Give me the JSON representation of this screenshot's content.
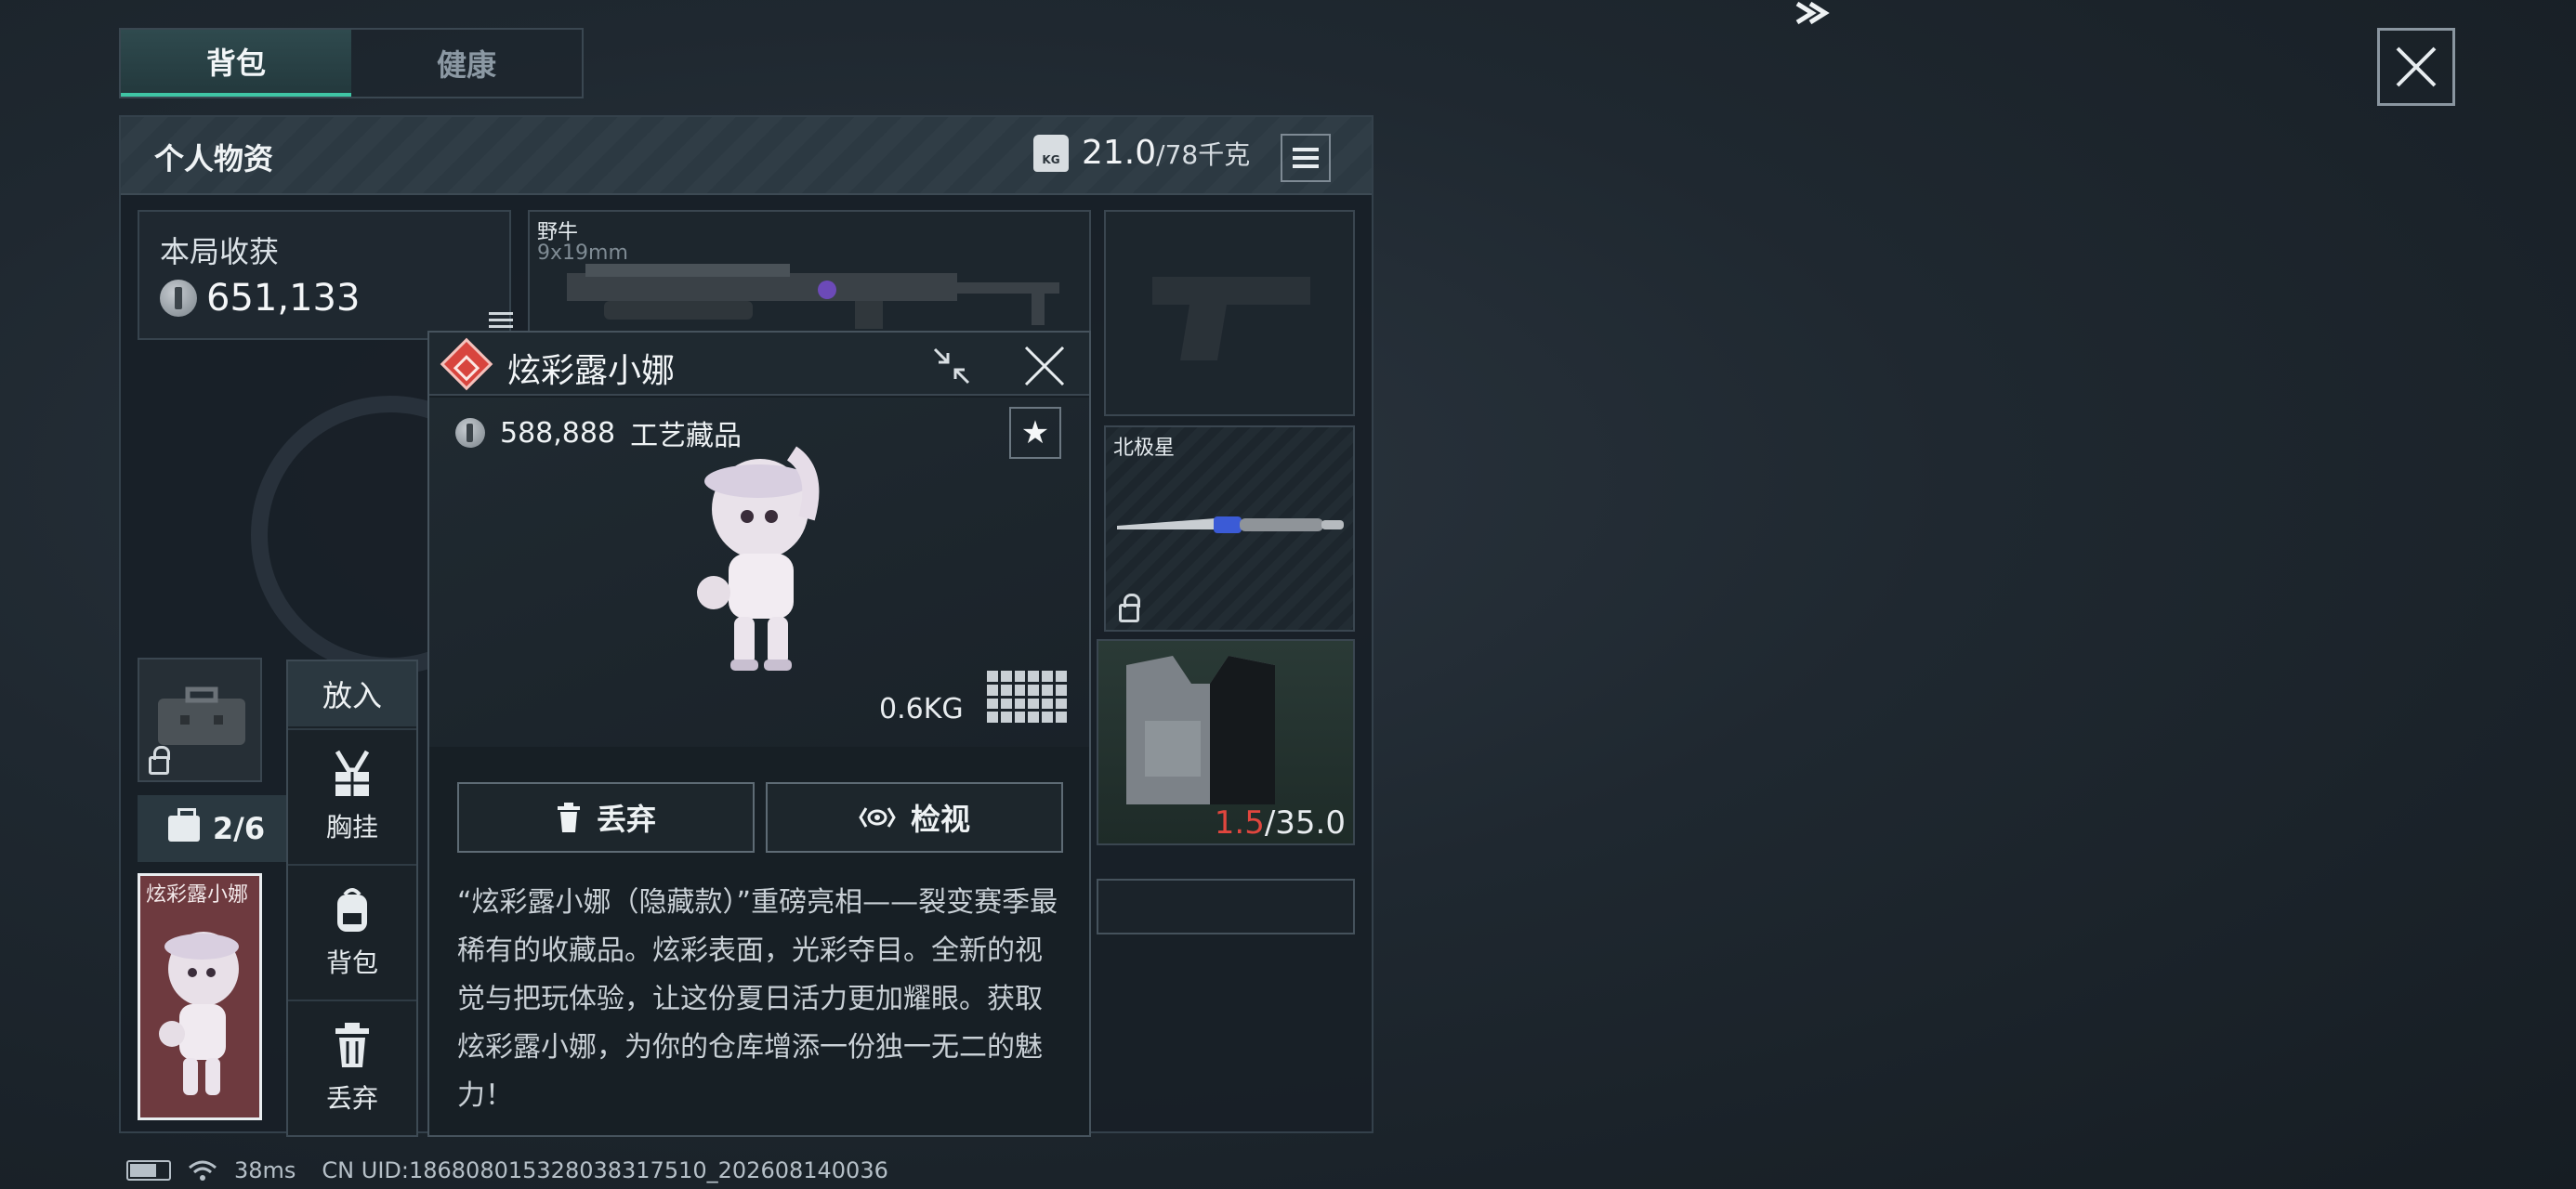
{
  "tabs": [
    {
      "label": "背包",
      "active": true
    },
    {
      "label": "健康",
      "active": false
    }
  ],
  "panel": {
    "title": "个人物资",
    "weight_current": "21.0",
    "weight_max": "/78千克",
    "kg_icon_text": "KG"
  },
  "haul": {
    "label": "本局收获",
    "value": "651,133"
  },
  "slots": {
    "rifle": {
      "name": "野牛",
      "caliber": "9x19mm"
    },
    "knife": {
      "name": "北极星"
    },
    "vest": {
      "durability_current": "1.5",
      "durability_max": "/35.0"
    }
  },
  "pocket": {
    "count": "2/6",
    "item_label": "炫彩露小娜"
  },
  "context_menu": {
    "header": "放入",
    "items": [
      {
        "label": "胸挂",
        "icon": "chest-rig-icon"
      },
      {
        "label": "背包",
        "icon": "backpack-icon"
      },
      {
        "label": "丢弃",
        "icon": "trash-icon"
      }
    ]
  },
  "detail": {
    "title": "炫彩露小娜",
    "price": "588,888",
    "category": "工艺藏品",
    "weight": "0.6KG",
    "favorite_glyph": "★",
    "drop_label": "丢弃",
    "view_label": "检视",
    "description": "“炫彩露小娜（隐藏款）”重磅亮相——裂变赛季最稀有的收藏品。炫彩表面，光彩夺目。全新的视觉与把玩体验，让这份夏日活力更加耀眼。获取炫彩露小娜，为你的仓库增添一份独一无二的魅力！"
  },
  "status_bar": {
    "ping": "38ms",
    "uid": "CN UID:1868080153280383175​10_202608140036"
  },
  "colors": {
    "accent": "#3fc5a5",
    "rarity_red": "#d8453e",
    "warning_red": "#e0463e",
    "collectible_slot_bg": "#6e3a3f"
  }
}
